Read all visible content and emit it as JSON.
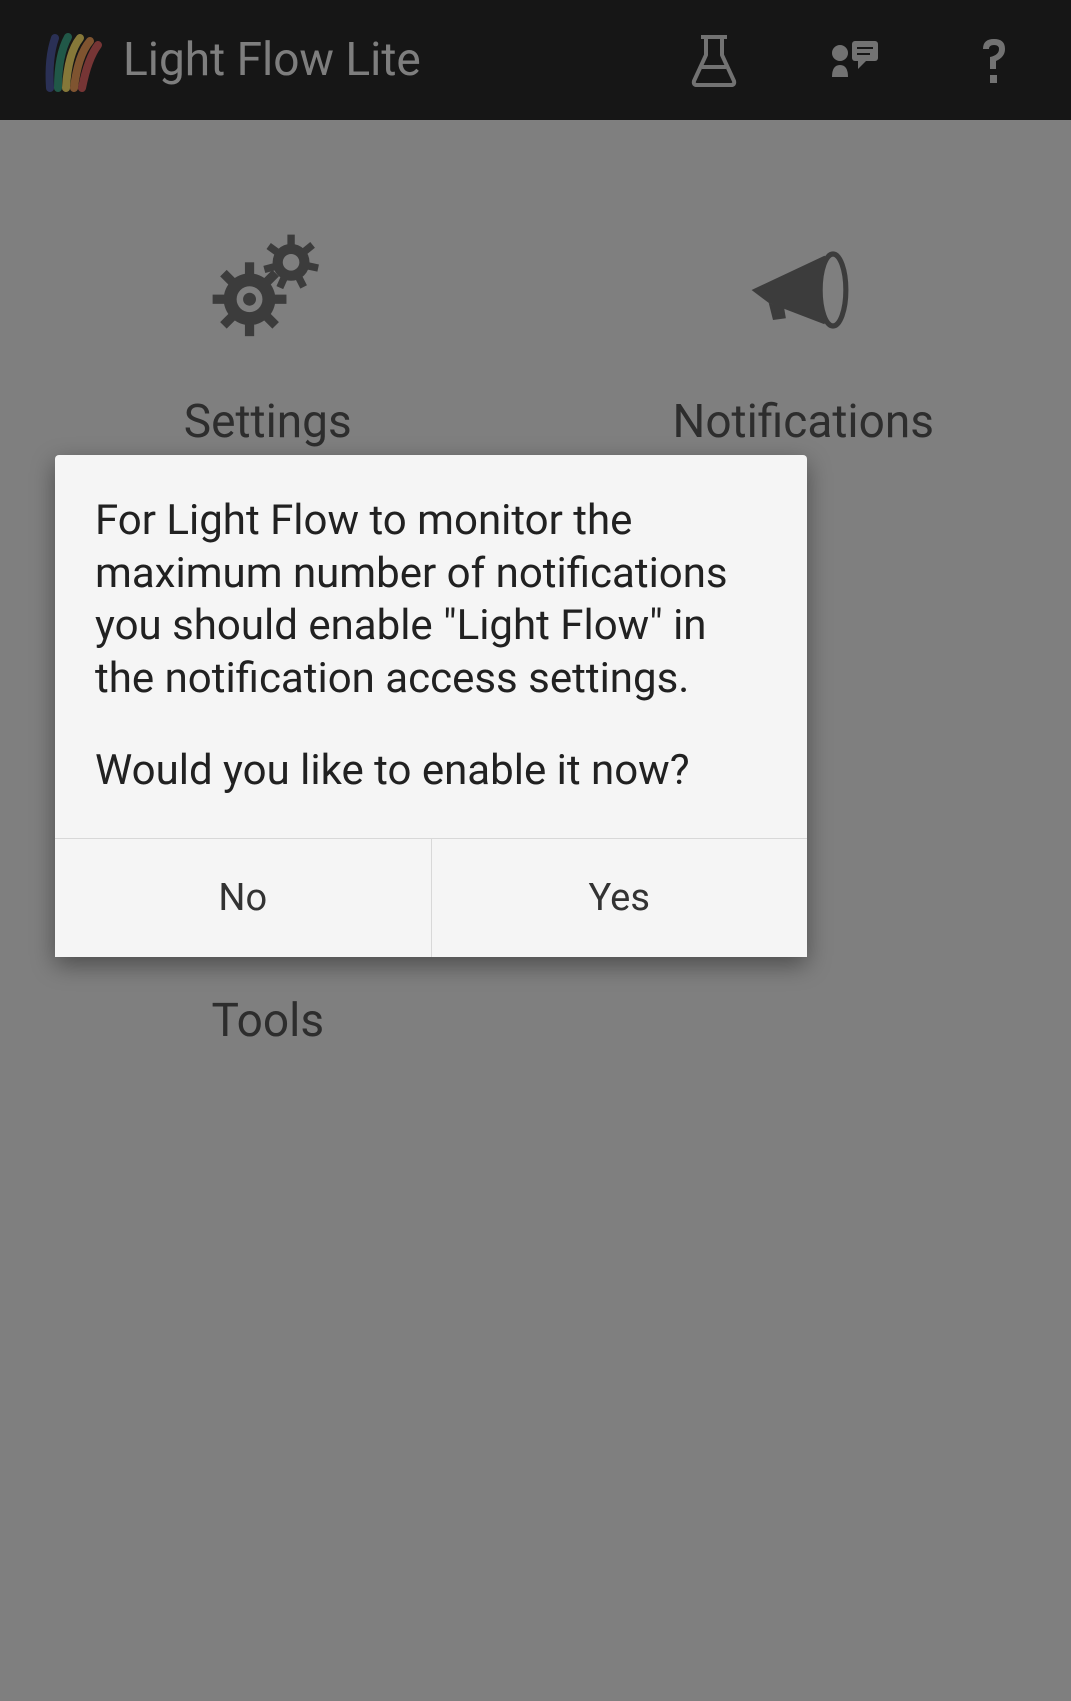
{
  "header": {
    "title": "Light Flow Lite"
  },
  "grid": {
    "settings": "Settings",
    "notifications": "Notifications",
    "tools": "Tools"
  },
  "dialog": {
    "message1": "For Light Flow to monitor the maximum number of notifications you should enable \"Light Flow\" in the notification access settings.",
    "message2": "Would you like to enable it now?",
    "no_label": "No",
    "yes_label": "Yes"
  }
}
